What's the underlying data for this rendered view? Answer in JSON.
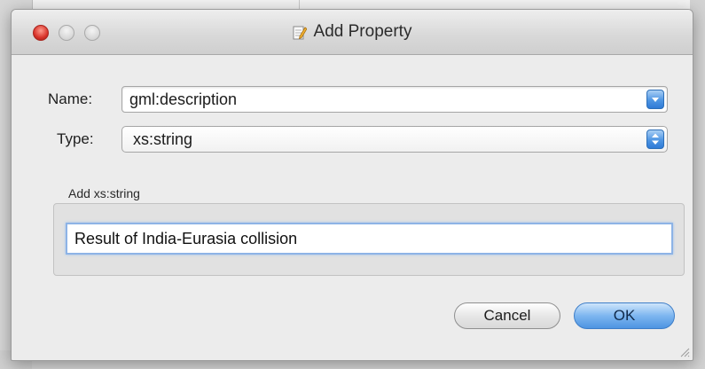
{
  "dialog": {
    "title": "Add Property",
    "name_label": "Name:",
    "name_value": "gml:description",
    "type_label": "Type:",
    "type_value": "xs:string",
    "group_title": "Add xs:string",
    "text_value": "Result of India-Eurasia collision",
    "cancel_label": "Cancel",
    "ok_label": "OK"
  },
  "icons": {
    "title_icon": "edit-document-icon",
    "name_dropdown": "chevron-down-icon",
    "type_dropdown": "up-down-arrows-icon",
    "resize": "resize-grip-icon"
  },
  "colors": {
    "accent": "#4e94e2",
    "close_button": "#d8332a",
    "dialog_bg": "#ececec"
  }
}
